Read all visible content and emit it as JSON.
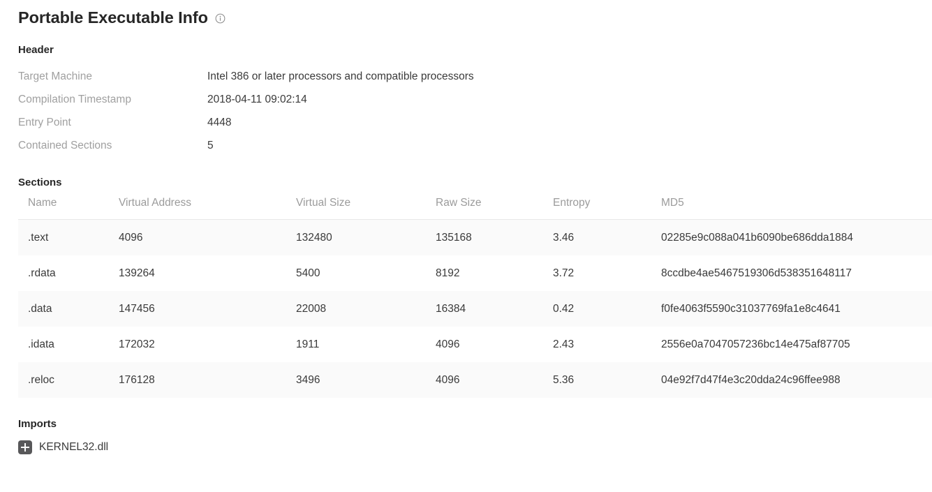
{
  "page": {
    "title": "Portable Executable Info",
    "info_icon": "info-circle-icon"
  },
  "header": {
    "heading": "Header",
    "rows": [
      {
        "label": "Target Machine",
        "value": "Intel 386 or later processors and compatible processors"
      },
      {
        "label": "Compilation Timestamp",
        "value": "2018-04-11 09:02:14"
      },
      {
        "label": "Entry Point",
        "value": "4448"
      },
      {
        "label": "Contained Sections",
        "value": "5"
      }
    ]
  },
  "sections": {
    "heading": "Sections",
    "columns": [
      "Name",
      "Virtual Address",
      "Virtual Size",
      "Raw Size",
      "Entropy",
      "MD5"
    ],
    "rows": [
      {
        "name": ".text",
        "virtual_address": "4096",
        "virtual_size": "132480",
        "raw_size": "135168",
        "entropy": "3.46",
        "md5": "02285e9c088a041b6090be686dda1884"
      },
      {
        "name": ".rdata",
        "virtual_address": "139264",
        "virtual_size": "5400",
        "raw_size": "8192",
        "entropy": "3.72",
        "md5": "8ccdbe4ae5467519306d538351648117"
      },
      {
        "name": ".data",
        "virtual_address": "147456",
        "virtual_size": "22008",
        "raw_size": "16384",
        "entropy": "0.42",
        "md5": "f0fe4063f5590c31037769fa1e8c4641"
      },
      {
        "name": ".idata",
        "virtual_address": "172032",
        "virtual_size": "1911",
        "raw_size": "4096",
        "entropy": "2.43",
        "md5": "2556e0a7047057236bc14e475af87705"
      },
      {
        "name": ".reloc",
        "virtual_address": "176128",
        "virtual_size": "3496",
        "raw_size": "4096",
        "entropy": "5.36",
        "md5": "04e92f7d47f4e3c20dda24c96ffee988"
      }
    ]
  },
  "imports": {
    "heading": "Imports",
    "items": [
      {
        "name": "KERNEL32.dll",
        "expand_icon": "plus-square-icon"
      }
    ]
  },
  "colors": {
    "text_primary": "#3a3a3a",
    "text_heading": "#262626",
    "text_muted": "#a0a0a0",
    "row_stripe": "#fafafa",
    "border": "#e8e8e8",
    "expand_icon_bg": "#58585a"
  }
}
